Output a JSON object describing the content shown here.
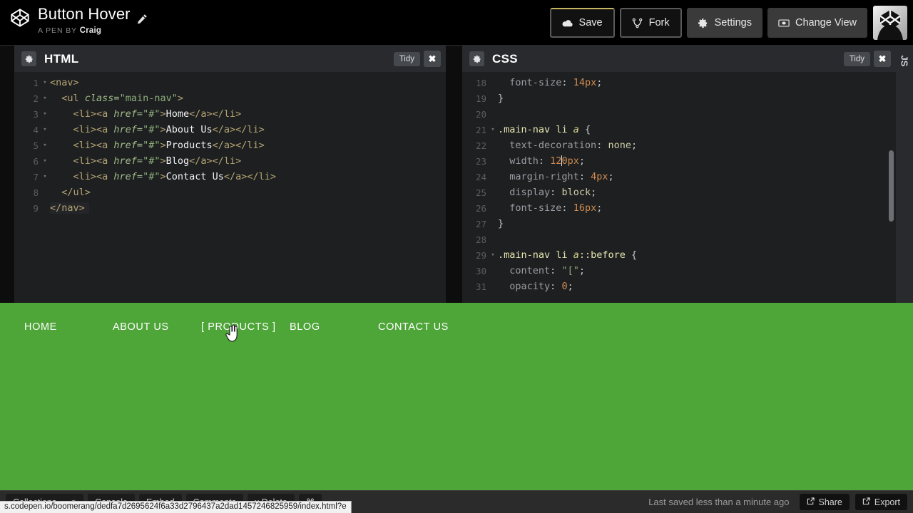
{
  "header": {
    "logo_icon": "codepen-logo-icon",
    "pen_title": "Button Hover",
    "edit_icon": "pencil-icon",
    "byline_prefix": "A PEN BY",
    "author": "Craig",
    "buttons": [
      {
        "label": "Save",
        "icon": "cloud-icon"
      },
      {
        "label": "Fork",
        "icon": "fork-icon"
      },
      {
        "label": "Settings",
        "icon": "gear-icon"
      },
      {
        "label": "Change View",
        "icon": "view-icon"
      }
    ],
    "avatar_icon": "codepen-avatar-icon"
  },
  "panels": {
    "html": {
      "title": "HTML",
      "settings_icon": "gear-icon",
      "tidy_label": "Tidy",
      "close_label": "✖",
      "active_line": 9,
      "lines": [
        {
          "n": 1,
          "fold": true,
          "tokens": [
            {
              "t": "tag",
              "v": "<nav>"
            }
          ]
        },
        {
          "n": 2,
          "fold": true,
          "tokens": [
            {
              "t": "plain",
              "v": "  "
            },
            {
              "t": "tag",
              "v": "<ul "
            },
            {
              "t": "aname",
              "v": "class="
            },
            {
              "t": "str",
              "v": "\"main-nav\""
            },
            {
              "t": "tag",
              "v": ">"
            }
          ]
        },
        {
          "n": 3,
          "fold": true,
          "tokens": [
            {
              "t": "plain",
              "v": "    "
            },
            {
              "t": "tag",
              "v": "<li><a "
            },
            {
              "t": "aname",
              "v": "href="
            },
            {
              "t": "str",
              "v": "\"#\""
            },
            {
              "t": "tag",
              "v": ">"
            },
            {
              "t": "text",
              "v": "Home"
            },
            {
              "t": "tag",
              "v": "</a></li>"
            }
          ]
        },
        {
          "n": 4,
          "fold": true,
          "tokens": [
            {
              "t": "plain",
              "v": "    "
            },
            {
              "t": "tag",
              "v": "<li><a "
            },
            {
              "t": "aname",
              "v": "href="
            },
            {
              "t": "str",
              "v": "\"#\""
            },
            {
              "t": "tag",
              "v": ">"
            },
            {
              "t": "text",
              "v": "About Us"
            },
            {
              "t": "tag",
              "v": "</a></li>"
            }
          ]
        },
        {
          "n": 5,
          "fold": true,
          "tokens": [
            {
              "t": "plain",
              "v": "    "
            },
            {
              "t": "tag",
              "v": "<li><a "
            },
            {
              "t": "aname",
              "v": "href="
            },
            {
              "t": "str",
              "v": "\"#\""
            },
            {
              "t": "tag",
              "v": ">"
            },
            {
              "t": "text",
              "v": "Products"
            },
            {
              "t": "tag",
              "v": "</a></li>"
            }
          ]
        },
        {
          "n": 6,
          "fold": true,
          "tokens": [
            {
              "t": "plain",
              "v": "    "
            },
            {
              "t": "tag",
              "v": "<li><a "
            },
            {
              "t": "aname",
              "v": "href="
            },
            {
              "t": "str",
              "v": "\"#\""
            },
            {
              "t": "tag",
              "v": ">"
            },
            {
              "t": "text",
              "v": "Blog"
            },
            {
              "t": "tag",
              "v": "</a></li>"
            }
          ]
        },
        {
          "n": 7,
          "fold": true,
          "tokens": [
            {
              "t": "plain",
              "v": "    "
            },
            {
              "t": "tag",
              "v": "<li><a "
            },
            {
              "t": "aname",
              "v": "href="
            },
            {
              "t": "str",
              "v": "\"#\""
            },
            {
              "t": "tag",
              "v": ">"
            },
            {
              "t": "text",
              "v": "Contact Us"
            },
            {
              "t": "tag",
              "v": "</a></li>"
            }
          ]
        },
        {
          "n": 8,
          "fold": false,
          "tokens": [
            {
              "t": "plain",
              "v": "  "
            },
            {
              "t": "tag",
              "v": "</ul>"
            }
          ]
        },
        {
          "n": 9,
          "fold": false,
          "tokens": [
            {
              "t": "tag",
              "v": "</nav>"
            }
          ]
        }
      ]
    },
    "css": {
      "title": "CSS",
      "settings_icon": "gear-icon",
      "tidy_label": "Tidy",
      "close_label": "✖",
      "first_visible_line": 18,
      "lines": [
        {
          "n": 18,
          "fold": false,
          "tokens": [
            {
              "t": "plain",
              "v": "  "
            },
            {
              "t": "prop",
              "v": "font-size"
            },
            {
              "t": "punc",
              "v": ": "
            },
            {
              "t": "num",
              "v": "14px"
            },
            {
              "t": "punc",
              "v": ";"
            }
          ]
        },
        {
          "n": 19,
          "fold": false,
          "tokens": [
            {
              "t": "punc",
              "v": "}"
            }
          ]
        },
        {
          "n": 20,
          "fold": false,
          "tokens": []
        },
        {
          "n": 21,
          "fold": true,
          "tokens": [
            {
              "t": "sel",
              "v": ".main-nav li "
            },
            {
              "t": "selit",
              "v": "a"
            },
            {
              "t": "punc",
              "v": " {"
            }
          ]
        },
        {
          "n": 22,
          "fold": false,
          "tokens": [
            {
              "t": "plain",
              "v": "  "
            },
            {
              "t": "prop",
              "v": "text-decoration"
            },
            {
              "t": "punc",
              "v": ": "
            },
            {
              "t": "val",
              "v": "none"
            },
            {
              "t": "punc",
              "v": ";"
            }
          ]
        },
        {
          "n": 23,
          "fold": false,
          "caret_after": "12",
          "tokens": [
            {
              "t": "plain",
              "v": "  "
            },
            {
              "t": "prop",
              "v": "width"
            },
            {
              "t": "punc",
              "v": ": "
            },
            {
              "t": "num",
              "v": "120px"
            },
            {
              "t": "punc",
              "v": ";"
            }
          ]
        },
        {
          "n": 24,
          "fold": false,
          "tokens": [
            {
              "t": "plain",
              "v": "  "
            },
            {
              "t": "prop",
              "v": "margin-right"
            },
            {
              "t": "punc",
              "v": ": "
            },
            {
              "t": "num",
              "v": "4px"
            },
            {
              "t": "punc",
              "v": ";"
            }
          ]
        },
        {
          "n": 25,
          "fold": false,
          "tokens": [
            {
              "t": "plain",
              "v": "  "
            },
            {
              "t": "prop",
              "v": "display"
            },
            {
              "t": "punc",
              "v": ": "
            },
            {
              "t": "val",
              "v": "block"
            },
            {
              "t": "punc",
              "v": ";"
            }
          ]
        },
        {
          "n": 26,
          "fold": false,
          "tokens": [
            {
              "t": "plain",
              "v": "  "
            },
            {
              "t": "prop",
              "v": "font-size"
            },
            {
              "t": "punc",
              "v": ": "
            },
            {
              "t": "num",
              "v": "16px"
            },
            {
              "t": "punc",
              "v": ";"
            }
          ]
        },
        {
          "n": 27,
          "fold": false,
          "tokens": [
            {
              "t": "punc",
              "v": "}"
            }
          ]
        },
        {
          "n": 28,
          "fold": false,
          "tokens": []
        },
        {
          "n": 29,
          "fold": true,
          "tokens": [
            {
              "t": "sel",
              "v": ".main-nav li "
            },
            {
              "t": "selit",
              "v": "a"
            },
            {
              "t": "sel",
              "v": "::before"
            },
            {
              "t": "punc",
              "v": " {"
            }
          ]
        },
        {
          "n": 30,
          "fold": false,
          "tokens": [
            {
              "t": "plain",
              "v": "  "
            },
            {
              "t": "prop",
              "v": "content"
            },
            {
              "t": "punc",
              "v": ": "
            },
            {
              "t": "strg",
              "v": "\"[\""
            },
            {
              "t": "punc",
              "v": ";"
            }
          ]
        },
        {
          "n": 31,
          "fold": false,
          "tokens": [
            {
              "t": "plain",
              "v": "  "
            },
            {
              "t": "prop",
              "v": "opacity"
            },
            {
              "t": "punc",
              "v": ": "
            },
            {
              "t": "num",
              "v": "0"
            },
            {
              "t": "punc",
              "v": ";"
            }
          ]
        }
      ]
    },
    "js_tab_label": "JS"
  },
  "preview": {
    "background_color": "#4ea538",
    "nav_items": [
      {
        "label": "HOME",
        "hovered": false
      },
      {
        "label": "ABOUT US",
        "hovered": false
      },
      {
        "label": "[ PRODUCTS ]",
        "hovered": true
      },
      {
        "label": "BLOG",
        "hovered": false
      },
      {
        "label": "CONTACT US",
        "hovered": false
      }
    ],
    "cursor_icon": "pointing-hand-cursor"
  },
  "footer": {
    "left_buttons": [
      {
        "label": "Collections",
        "icon": "chevron-down-icon"
      },
      {
        "label": "Console",
        "icon": ""
      },
      {
        "label": "Embed",
        "icon": ""
      },
      {
        "label": "Comments",
        "icon": ""
      },
      {
        "label": "x Delete",
        "icon": ""
      },
      {
        "label": "⌘",
        "icon": "command-icon"
      }
    ],
    "saved_status": "Last saved less than a minute ago",
    "share_label": "Share",
    "export_label": "Export",
    "share_icon": "external-link-icon",
    "export_icon": "external-link-icon"
  },
  "status_bar": {
    "url": "s.codepen.io/boomerang/dedfa7d2695624f6a33d2796437a2dad1457246825959/index.html?e"
  }
}
